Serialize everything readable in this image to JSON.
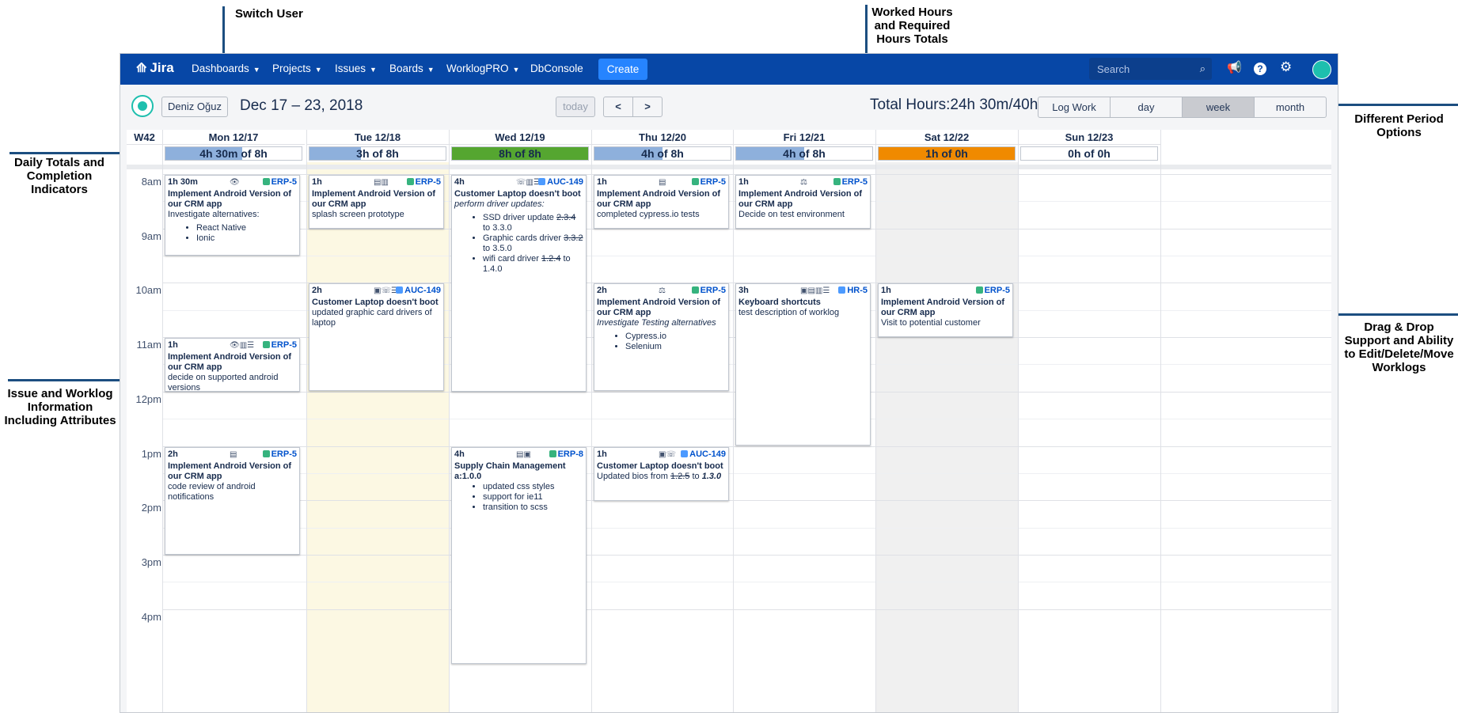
{
  "callouts": {
    "switch_user": "Switch User",
    "worked_hours": "Worked Hours\nand Required\nHours Totals",
    "period_options": "Different Period\nOptions",
    "daily_totals": "Daily Totals and\nCompletion\nIndicators",
    "issue_info": "Issue and Worklog\nInformation\nIncluding Attributes",
    "drag_drop": "Drag & Drop\nSupport and Ability\nto Edit/Delete/Move\nWorklogs"
  },
  "nav": {
    "logo": "Jira",
    "items": [
      {
        "label": "Dashboards",
        "chevron": true
      },
      {
        "label": "Projects",
        "chevron": true
      },
      {
        "label": "Issues",
        "chevron": true
      },
      {
        "label": "Boards",
        "chevron": true
      },
      {
        "label": "WorklogPRO",
        "chevron": true
      },
      {
        "label": "DbConsole",
        "chevron": false
      }
    ],
    "create_label": "Create",
    "search_placeholder": "Search",
    "icons": [
      "megaphone-icon",
      "help-icon",
      "settings-icon",
      "avatar"
    ]
  },
  "toolbar": {
    "user_name": "Deniz Oğuz",
    "date_range": "Dec 17 – 23, 2018",
    "today_label": "today",
    "prev_label": "<",
    "next_label": ">",
    "total_hours": "Total Hours:24h 30m/40h",
    "log_work_label": "Log Work",
    "period_day": "day",
    "period_week": "week",
    "period_month": "month",
    "selected_period": "week"
  },
  "calendar": {
    "week_label": "W42",
    "days": [
      {
        "label": "Mon 12/17",
        "total": "4h 30m of 8h",
        "completion": 0.5625,
        "fill_color": "#8eb0dc",
        "highlight": false,
        "weekend": false
      },
      {
        "label": "Tue 12/18",
        "total": "3h of 8h",
        "completion": 0.375,
        "fill_color": "#8eb0dc",
        "highlight": true,
        "weekend": false
      },
      {
        "label": "Wed 12/19",
        "total": "8h of 8h",
        "completion": 1.0,
        "fill_color": "#55a630",
        "highlight": false,
        "weekend": false
      },
      {
        "label": "Thu 12/20",
        "total": "4h of 8h",
        "completion": 0.5,
        "fill_color": "#8eb0dc",
        "highlight": false,
        "weekend": false
      },
      {
        "label": "Fri 12/21",
        "total": "4h of 8h",
        "completion": 0.5,
        "fill_color": "#8eb0dc",
        "highlight": false,
        "weekend": false
      },
      {
        "label": "Sat 12/22",
        "total": "1h of 0h",
        "completion": 1.0,
        "fill_color": "#f08a00",
        "highlight": false,
        "weekend": true
      },
      {
        "label": "Sun 12/23",
        "total": "0h of 0h",
        "completion": 0,
        "fill_color": "#8eb0dc",
        "highlight": false,
        "weekend": false
      }
    ],
    "time_labels": [
      "8am",
      "9am",
      "10am",
      "11am",
      "12pm",
      "1pm",
      "2pm",
      "3pm",
      "4pm"
    ]
  },
  "worklogs": [
    {
      "day": 0,
      "start": "08:00",
      "hours": 1.5,
      "duration": "1h 30m",
      "attrs": "👁",
      "issue": "ERP-5",
      "issue_type": "story",
      "title": "Implement Android Version of our CRM app",
      "desc": "Investigate alternatives:",
      "desc_italic": false,
      "list": [
        {
          "text": "React Native"
        },
        {
          "text": "Ionic"
        }
      ]
    },
    {
      "day": 0,
      "start": "11:00",
      "hours": 1,
      "duration": "1h",
      "attrs": "👁▥☰",
      "issue": "ERP-5",
      "issue_type": "story",
      "title": "Implement Android Version of our CRM app",
      "desc": "decide on supported android versions",
      "desc_italic": false,
      "list": []
    },
    {
      "day": 0,
      "start": "13:00",
      "hours": 2,
      "duration": "2h",
      "attrs": "▤",
      "issue": "ERP-5",
      "issue_type": "story",
      "title": "Implement Android Version of our CRM app",
      "desc": "code review of android notifications",
      "desc_italic": false,
      "list": []
    },
    {
      "day": 1,
      "start": "08:00",
      "hours": 1,
      "duration": "1h",
      "attrs": "▤▥",
      "issue": "ERP-5",
      "issue_type": "story",
      "title": "Implement Android Version of our CRM app",
      "desc": "splash screen prototype",
      "desc_italic": false,
      "list": []
    },
    {
      "day": 1,
      "start": "10:00",
      "hours": 2,
      "duration": "2h",
      "attrs": "▣☏☰",
      "issue": "AUC-149",
      "issue_type": "task",
      "title": "Customer Laptop doesn't boot",
      "desc": "updated graphic card drivers of laptop",
      "desc_italic": false,
      "list": []
    },
    {
      "day": 2,
      "start": "08:00",
      "hours": 4,
      "duration": "4h",
      "attrs": "☏▥☰",
      "issue": "AUC-149",
      "issue_type": "task",
      "title": "Customer Laptop doesn't boot",
      "desc": "perform driver updates:",
      "desc_italic": true,
      "list": [
        {
          "pre": "SSD driver update ",
          "strike": "2.3.4",
          "post": " to 3.3.0"
        },
        {
          "pre": "Graphic cards driver ",
          "strike": "3.3.2",
          "post": " to 3.5.0"
        },
        {
          "pre": "wifi card driver ",
          "strike": "1.2.4",
          "post": " to 1.4.0"
        }
      ]
    },
    {
      "day": 2,
      "start": "13:00",
      "hours": 4,
      "duration": "4h",
      "attrs": "▤▣",
      "issue": "ERP-8",
      "issue_type": "story",
      "title": "Supply Chain Management a:1.0.0",
      "desc": "",
      "desc_italic": false,
      "list": [
        {
          "text": "updated css styles"
        },
        {
          "text": "support for ie11"
        },
        {
          "text": "transition to scss"
        }
      ]
    },
    {
      "day": 3,
      "start": "08:00",
      "hours": 1,
      "duration": "1h",
      "attrs": "▤",
      "issue": "ERP-5",
      "issue_type": "story",
      "title": "Implement Android Version of our CRM app",
      "desc": "completed cypress.io tests",
      "desc_italic": false,
      "list": []
    },
    {
      "day": 3,
      "start": "10:00",
      "hours": 2,
      "duration": "2h",
      "attrs": "⚖",
      "issue": "ERP-5",
      "issue_type": "story",
      "title": "Implement Android Version of our CRM app",
      "desc": "Investigate Testing alternatives",
      "desc_italic": true,
      "list": [
        {
          "text": "Cypress.io"
        },
        {
          "text": "Selenium"
        }
      ]
    },
    {
      "day": 3,
      "start": "13:00",
      "hours": 1,
      "duration": "1h",
      "attrs": "▣☏",
      "issue": "AUC-149",
      "issue_type": "task",
      "title": "Customer Laptop doesn't boot",
      "desc_pre": "Updated bios from ",
      "desc_strike": "1.2.5",
      "desc_mid": " to ",
      "desc_bold_italic": "1.3.0",
      "desc": "",
      "desc_italic": false,
      "list": []
    },
    {
      "day": 4,
      "start": "08:00",
      "hours": 1,
      "duration": "1h",
      "attrs": "⚖",
      "issue": "ERP-5",
      "issue_type": "story",
      "title": "Implement Android Version of our CRM app",
      "desc": "Decide on test environment",
      "desc_italic": false,
      "list": []
    },
    {
      "day": 4,
      "start": "10:00",
      "hours": 3,
      "duration": "3h",
      "attrs": "▣▤▥☰",
      "issue": "HR-5",
      "issue_type": "task",
      "title": "Keyboard shortcuts",
      "desc": "test description of worklog",
      "desc_italic": false,
      "list": []
    },
    {
      "day": 5,
      "start": "10:00",
      "hours": 1,
      "duration": "1h",
      "attrs": "",
      "issue": "ERP-5",
      "issue_type": "story",
      "title": "Implement Android Version of our CRM app",
      "desc": "Visit to potential customer",
      "desc_italic": false,
      "list": []
    }
  ]
}
